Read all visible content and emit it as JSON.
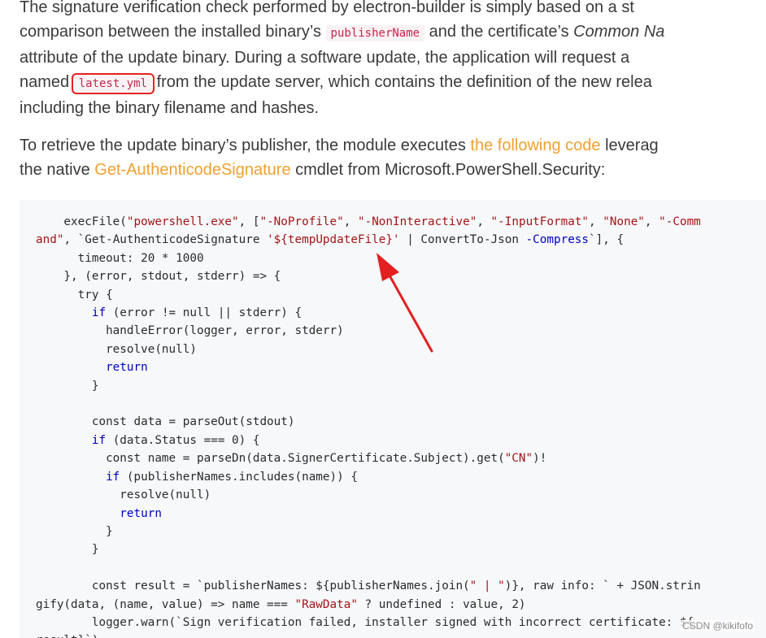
{
  "paragraph1": {
    "line1": "The signature verification check performed by electron-builder is simply based on a st",
    "line2_a": "comparison between the installed binary’s ",
    "line2_code": "publisherName",
    "line2_b": " and the certificate’s ",
    "line2_em": "Common Na",
    "line3": "attribute of the update binary. During a software update, the application will request a",
    "line4_a": "named ",
    "line4_code": "latest.yml",
    "line4_b": " from the update server, which contains the definition of the new relea",
    "line5": "including the binary filename and hashes."
  },
  "paragraph2": {
    "line1_a": "To retrieve the update binary’s publisher, the module executes ",
    "line1_link": "the following code",
    "line1_b": " leverag",
    "line2_a": "the native ",
    "line2_link": "Get-AuthenticodeSignature",
    "line2_b": " cmdlet from Microsoft.PowerShell.Security:"
  },
  "colors": {
    "text": "#3a3a3a",
    "link": "#f0a030",
    "inline_code": "#c7254e",
    "highlight_box": "#e32020",
    "arrow": "#e32020",
    "code_bg": "#f6f8fa",
    "code_string": "#a31515",
    "code_keyword": "#0000c0"
  },
  "code_lines": [
    [
      [
        "plain",
        "    execFile("
      ],
      [
        "str",
        "\"powershell.exe\""
      ],
      [
        "plain",
        ", ["
      ],
      [
        "str",
        "\"-NoProfile\""
      ],
      [
        "plain",
        ", "
      ],
      [
        "str",
        "\"-NonInteractive\""
      ],
      [
        "plain",
        ", "
      ],
      [
        "str",
        "\"-InputFormat\""
      ],
      [
        "plain",
        ", "
      ],
      [
        "str",
        "\"None\""
      ],
      [
        "plain",
        ", "
      ],
      [
        "str",
        "\"-Comm"
      ]
    ],
    [
      [
        "str",
        "and\""
      ],
      [
        "plain",
        ", `Get-AuthenticodeSignature "
      ],
      [
        "str",
        "'${tempUpdateFile}'"
      ],
      [
        "plain",
        " | ConvertTo-Json "
      ],
      [
        "kw",
        "-Compress"
      ],
      [
        "plain",
        "`], {"
      ]
    ],
    [
      [
        "plain",
        "      timeout: 20 * 1000"
      ]
    ],
    [
      [
        "plain",
        "    }, (error, stdout, stderr) => {"
      ]
    ],
    [
      [
        "plain",
        "      try {"
      ]
    ],
    [
      [
        "plain",
        "        "
      ],
      [
        "kw",
        "if"
      ],
      [
        "plain",
        " (error != null || stderr) {"
      ]
    ],
    [
      [
        "plain",
        "          handleError(logger, error, stderr)"
      ]
    ],
    [
      [
        "plain",
        "          resolve(null)"
      ]
    ],
    [
      [
        "plain",
        "          "
      ],
      [
        "kw",
        "return"
      ]
    ],
    [
      [
        "plain",
        "        }"
      ]
    ],
    [
      [
        "plain",
        ""
      ]
    ],
    [
      [
        "plain",
        "        const data = parseOut(stdout)"
      ]
    ],
    [
      [
        "plain",
        "        "
      ],
      [
        "kw",
        "if"
      ],
      [
        "plain",
        " (data.Status === 0) {"
      ]
    ],
    [
      [
        "plain",
        "          const name = parseDn(data.SignerCertificate.Subject).get("
      ],
      [
        "str",
        "\"CN\""
      ],
      [
        "plain",
        ")!"
      ]
    ],
    [
      [
        "plain",
        "          "
      ],
      [
        "kw",
        "if"
      ],
      [
        "plain",
        " (publisherNames.includes(name)) {"
      ]
    ],
    [
      [
        "plain",
        "            resolve(null)"
      ]
    ],
    [
      [
        "plain",
        "            "
      ],
      [
        "kw",
        "return"
      ]
    ],
    [
      [
        "plain",
        "          }"
      ]
    ],
    [
      [
        "plain",
        "        }"
      ]
    ],
    [
      [
        "plain",
        ""
      ]
    ],
    [
      [
        "plain",
        "        const result = `publisherNames: ${publisherNames.join("
      ],
      [
        "str",
        "\" | \""
      ],
      [
        "plain",
        ")}, raw info: ` + JSON.strin"
      ]
    ],
    [
      [
        "plain",
        "gify(data, (name, value) => name === "
      ],
      [
        "str",
        "\"RawData\""
      ],
      [
        "plain",
        " ? undefined : value, 2)"
      ]
    ],
    [
      [
        "plain",
        "        logger.warn(`Sign verification failed, installer signed with incorrect certificate: ${"
      ]
    ],
    [
      [
        "plain",
        "result}`)"
      ]
    ]
  ],
  "watermark": "CSDN @kikifofo"
}
